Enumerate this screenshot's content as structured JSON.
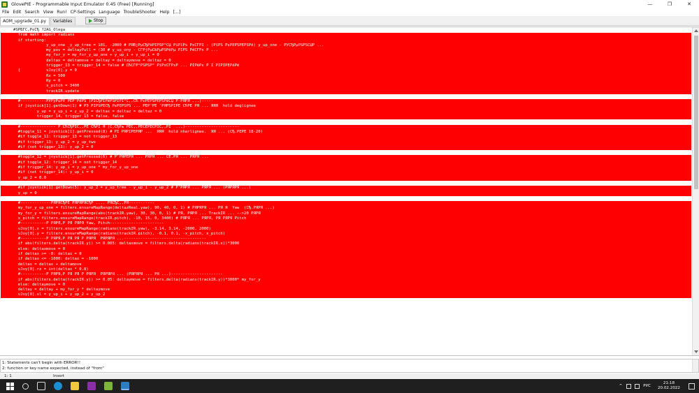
{
  "window": {
    "title": "GlovePIE - Programmable Input Emulator 0.45 (Free) [Running]",
    "minimize": "—",
    "restore": "❐",
    "close": "✕"
  },
  "menu": [
    "File",
    "Edit",
    "Search",
    "View",
    "Run!",
    "CP-Settings",
    "Language",
    "TroubleShooter",
    "Help",
    "[...]"
  ],
  "tabs": {
    "script": "AOM_upgrade_01.py",
    "variables": "Variables",
    "run_label": "Stop"
  },
  "code_lines": [
    {
      "text": "#ŠPБҐС,РєСЂ ?2АG_Оlеgа",
      "hl": false
    },
    {
      "text": "  from math import radians",
      "hl": true
    },
    {
      "text": "  if starting:",
      "hl": true
    },
    {
      "text": "              y_up_one _y_up_tree = 101, -2000 # РЯВјРµСЂРёРІРЅР°СЏ РіРїРѕ РєСЃРЇ - (РїРЅ РєРЁРЅРЁРЅРё) y_up_one - РЎСЂРµРЅРЅСЏР ...",
      "hl": true
    },
    {
      "text": "              my_pov = deltayPull = (30 # y_up_ony - СЃРјРµС‰РµРЅРёРµ РІРЅ РёСЃРє Р ...",
      "hl": true
    },
    {
      "text": "              my_for_y = my_for_y_up_one + y_up_i + y_up_i = 0",
      "hl": true
    },
    {
      "text": "              deltax = deltamove = deltay = deltaymove = deltaz = 0",
      "hl": true
    },
    {
      "text": "              trigger_13 = trigger_14 = false # СЋСЃР°РЅРЅР° РїРѕСЃРѕР ... РІРёРє Р І РЇРЇРЁРёРё",
      "hl": true
    },
    {
      "text": "  {           vJoy[0].y = 0",
      "hl": true
    },
    {
      "text": "              Rx = 500",
      "hl": true
    },
    {
      "text": "              Ry = 0",
      "hl": true
    },
    {
      "text": "              x_pitch = 3400",
      "hl": true
    },
    {
      "text": "              trackIR.update",
      "hl": true
    },
    {
      "text": "",
      "hl": false
    },
    {
      "text": "  #-----------РЎРўРџРЎ РЁР'РёРЅ (РЇСЂРЇРёРЅРЇРЇ°С‚,СЋ РєРЁРЅРЁРЅРёСЏ Р-РЯРЯ ...)-----",
      "hl": true
    },
    {
      "text": "  if joystick[1].getDown(1) # РЭ РЇРЅРЁСЂ РєРЁРЅРЅ ... РЁР'РЁ 'РЯРЅРЇРЁ СЋРЁ РЯ ... ЯЯЯ  hold deglignee",
      "hl": true
    },
    {
      "text": "          y_up = y_up_i = y_up_2 = deltax = deltaz = deltaz = 0",
      "hl": true
    },
    {
      "text": "          trigger_14, trigger_13 = false, false",
      "hl": true
    },
    {
      "text": "",
      "hl": false
    },
    {
      "text": "  #--------------- Р СЋСЂРЇС‚,РЁ СЋРЇ Я (С,СЂР± РЁС‚,РЁСЁРЁСРЇС‚,РЇ  ...)-----------------------",
      "hl": true
    },
    {
      "text": "  #toggle_11 = joystick[1].getPressed(8) # РЇ РЯРЇРЁРЯР ...  ЯЯЯ  hold nharlignee.  ЯЯ ... (СЂ.РЁРЁ 18-20)",
      "hl": true
    },
    {
      "text": "  #if toggle_11: trigger_13 = not trigger_13",
      "hl": true
    },
    {
      "text": "  #if trigger_13: y_up_2 = y_up_two",
      "hl": true
    },
    {
      "text": "  #if (not trigger_13): y_up_2 = 0",
      "hl": true
    },
    {
      "text": "",
      "hl": false
    },
    {
      "text": "  #toggle_12 = joystick[1].getPressed(6) # Р'РЯРЁРЯ ... РЯРЯ ... СЁ.РЯ ... РЯРЯ ...",
      "hl": true
    },
    {
      "text": "  #if toggle_12: trigger_14 = not trigger_14",
      "hl": true
    },
    {
      "text": "  #if trigger_14: y_up_i = y_up_one * my_for_y_up_one",
      "hl": true
    },
    {
      "text": "  #if (not trigger_14): y_up_i = 0",
      "hl": true
    },
    {
      "text": "  y_up_2 = 0.0",
      "hl": true
    },
    {
      "text": "",
      "hl": false
    },
    {
      "text": "  #if joystick[1].getDown(5): y_up_2 = y_up_tree - y_up_i - y_up_2 # Р'РЯРЯ ... РЯРЯ ... (РЯРЯРЯ ...)",
      "hl": true
    },
    {
      "text": "  y_up = 0",
      "hl": true
    },
    {
      "text": "",
      "hl": false
    },
    {
      "text": "  #-------------РЯРЯСЂРЁ РЯРЯРЯСЂР .... РЯСЂС‚,РЯ-----------",
      "hl": true
    },
    {
      "text": "  my_for_y_up_one = filters.ensureMapRange(deltazReal.yaw), 90, 40, 0, 1) # РЯРЯРЯ ... РЯ Я  Yaw  (СЂ.РЯРЯ ...)",
      "hl": true
    },
    {
      "text": "  my_for_y = filters.ensureMapRange(abs(trackIR.yaw), 30, 30, 0, 1) # РЯ, РЯРЯ ... TrackIR ... -->20 РЯРЯ",
      "hl": true
    },
    {
      "text": "  x_pitch = filters.ensureMapRange(trackIR.pitch), -10, 15, 0, 3400) # РЯРЯ ... РЯРЯ, РЯ РЯРЯ Pitch",
      "hl": true
    },
    {
      "text": "  #-----------Р РЯРЯ,Р РЯ РЯРЯ Yaw, Pitch-----------------------",
      "hl": true
    },
    {
      "text": "  vJoy[0].x = filters.ensureMapRange(radians(trackIR.yaw), -3.14, 3.14, -2000, 2000)",
      "hl": true
    },
    {
      "text": "  vJoy[0].y = filters.ensureMapRange(radians(trackIR.pitch), -0.1, 0.1, -x_pitch, x_pitch)",
      "hl": true
    },
    {
      "text": "  #-----------Р РЯРЯ,Р РЯ РЯ Р РЯРЯ  РЯРЯРЯ ...-----------------------------------",
      "hl": true
    },
    {
      "text": "  if abs(filters.delta(trackIR.y)) >= 0.005: deltaxmove = filters.delta(radians(trackIR.x))*3000",
      "hl": true
    },
    {
      "text": "  else: deltaxmove = 0",
      "hl": true
    },
    {
      "text": "  if deltax >= -0: deltax = 0",
      "hl": true
    },
    {
      "text": "  if deltax <= -1000: deltax = -1000",
      "hl": true
    },
    {
      "text": "  deltax = deltax + deltamove",
      "hl": true
    },
    {
      "text": "  vJoy[0].rz = int(deltax * 0.8)",
      "hl": true
    },
    {
      "text": "  #-----------Р РЯРЯ,Р РЯ РЯ Р РЯРЯ  РЯРЯРЯ ... (РЯРЯРЯ ... РЯ ...)----------------------",
      "hl": true
    },
    {
      "text": "  if abs(filters.delta(trackIR.y)) >= 0.05: deltaymove = filters.delta(radians(trackIR.y))*3000* my_for_y",
      "hl": true
    },
    {
      "text": "  else: deltaymove = 0",
      "hl": true
    },
    {
      "text": "  deltay = deltay + my_for_y * deltaymove",
      "hl": true
    },
    {
      "text": "  vJoy[0].sl = y_up_i + y_up_2 + y_up_2",
      "hl": true
    }
  ],
  "messages": [
    "1: Statements can't begin with ERROR!!",
    "2: function or key name expected, instead of \"from\""
  ],
  "status": {
    "position": "1:  1",
    "mode": "Insert"
  },
  "taskbar": {
    "lang": "РУС",
    "time": "21:18",
    "date": "20.02.2022",
    "icons": [
      "start-icon",
      "search-icon",
      "task-view-icon",
      "edge-icon",
      "explorer-icon",
      "winrar-icon",
      "glovepie-icon",
      "app-icon"
    ]
  },
  "colors": {
    "error_highlight": "#ff0000",
    "taskbar": "#1f1f1f"
  }
}
